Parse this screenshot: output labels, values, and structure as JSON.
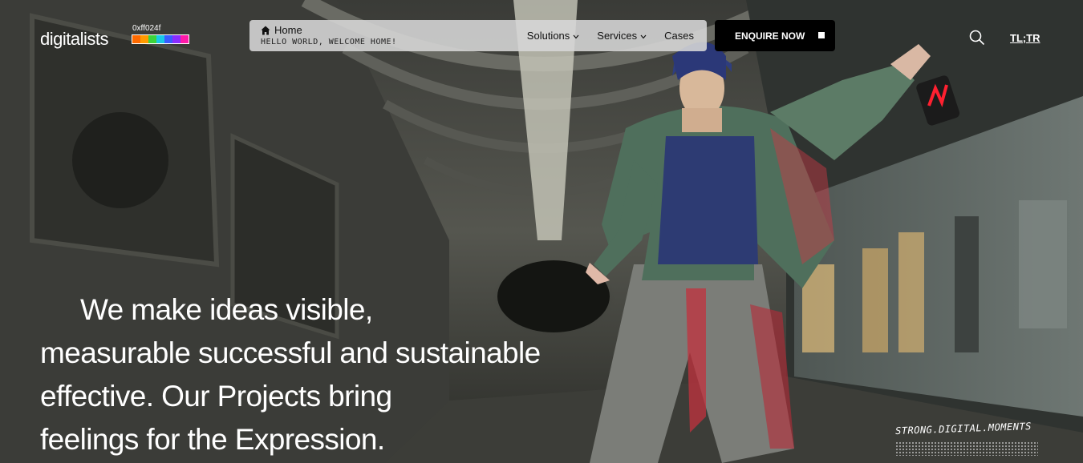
{
  "header": {
    "logo_text": "digitalists",
    "color_code": "0xff024f",
    "swatches": [
      "#ff6a00",
      "#ff9a00",
      "#3cd43c",
      "#19c9e8",
      "#3a5bff",
      "#8a2cff",
      "#ff1aa8"
    ]
  },
  "nav": {
    "home_label": "Home",
    "welcome_text": "HELLO WORLD, WELCOME HOME!",
    "items": [
      {
        "label": "Solutions",
        "has_dropdown": true
      },
      {
        "label": "Services",
        "has_dropdown": true
      },
      {
        "label": "Cases",
        "has_dropdown": false
      }
    ]
  },
  "cta": {
    "label": "ENQUIRE NOW"
  },
  "icons": {
    "search": "search-icon",
    "home": "home-icon"
  },
  "language": {
    "label": "TL;TR"
  },
  "hero": {
    "headline_lines": [
      "We make ideas visible,",
      "measurable successful and sustainable",
      "effective. Our Projects bring",
      "feelings for the Expression."
    ],
    "tagline": "STRONG.DIGITAL.MOMENTS"
  }
}
